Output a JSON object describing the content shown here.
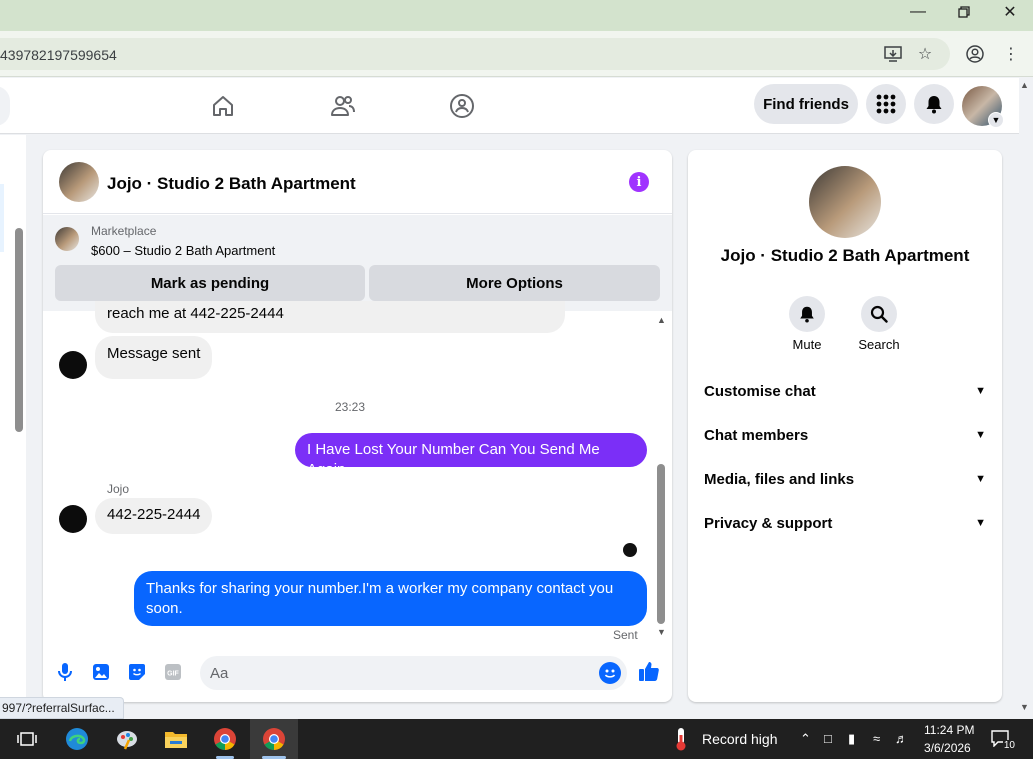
{
  "browser": {
    "url": "439782197599654",
    "minimize_icon": "minimize-icon",
    "maximize_icon": "restore-icon",
    "close_icon": "close-icon",
    "status_link": "997/?referralSurfac..."
  },
  "header": {
    "find_friends": "Find friends"
  },
  "chat": {
    "title": "Jojo · Studio 2 Bath Apartment",
    "marketplace_label": "Marketplace",
    "marketplace_item": "$600 – Studio 2 Bath Apartment",
    "mark_pending": "Mark as pending",
    "more_options": "More Options",
    "messages": [
      {
        "direction": "in",
        "text": "reach me at 442-225-2444"
      },
      {
        "direction": "in",
        "text": "Message sent"
      },
      {
        "direction": "out",
        "text": "I Have Lost Your Number Can You Send Me Again"
      },
      {
        "direction": "in",
        "text": "442-225-2444"
      },
      {
        "direction": "out",
        "text": "Thanks for sharing your number.I'm a worker my company contact you soon."
      }
    ],
    "timestamp": "23:23",
    "sender_name": "Jojo",
    "sent_status": "Sent",
    "composer_placeholder": "Aa",
    "colors": {
      "purple": "#7b2ff7",
      "blue": "#0866ff",
      "accent": "#a033ff"
    }
  },
  "details": {
    "title": "Jojo · Studio 2 Bath Apartment",
    "mute": "Mute",
    "search": "Search",
    "sections": [
      "Customise chat",
      "Chat members",
      "Media, files and links",
      "Privacy & support"
    ]
  },
  "taskbar": {
    "weather": "Record high",
    "time": "11:24 PM",
    "date": "3/6/2026",
    "notifications": "10"
  }
}
